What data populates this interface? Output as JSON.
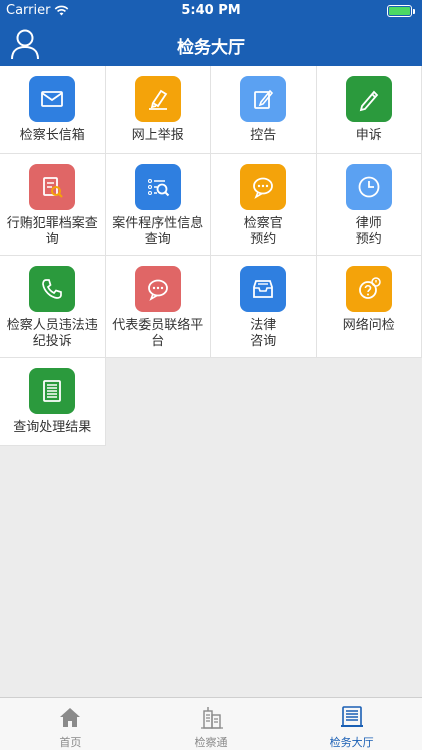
{
  "status_bar": {
    "carrier": "Carrier",
    "time": "5:40 PM",
    "battery_level": 1.0
  },
  "nav": {
    "title": "检务大厅"
  },
  "colors": {
    "primary": "#1a5fb4",
    "blue": "#2f7fe0",
    "orange": "#f4a30a",
    "light_blue": "#5ba1f2",
    "green": "#2b9a3d",
    "red": "#e06666"
  },
  "services": [
    {
      "label": "检察长信箱",
      "icon": "mail-icon",
      "color": "#2f7fe0"
    },
    {
      "label": "网上举报",
      "icon": "highlighter-icon",
      "color": "#f4a30a"
    },
    {
      "label": "控告",
      "icon": "edit-icon",
      "color": "#5ba1f2"
    },
    {
      "label": "申诉",
      "icon": "pencil-icon",
      "color": "#2b9a3d"
    },
    {
      "label": "行贿犯罪档案查询",
      "icon": "document-search-icon",
      "color": "#e06666"
    },
    {
      "label": "案件程序性信息查询",
      "icon": "list-search-icon",
      "color": "#2f7fe0"
    },
    {
      "label": "检察官\n预约",
      "icon": "chat-bubble-icon",
      "color": "#f4a30a"
    },
    {
      "label": "律师\n预约",
      "icon": "clock-icon",
      "color": "#5ba1f2"
    },
    {
      "label": "检察人员违法违纪投诉",
      "icon": "phone-icon",
      "color": "#2b9a3d"
    },
    {
      "label": "代表委员联络平台",
      "icon": "chat-bubble-icon",
      "color": "#e06666"
    },
    {
      "label": "法律\n咨询",
      "icon": "inbox-icon",
      "color": "#2f7fe0"
    },
    {
      "label": "网络问检",
      "icon": "question-bubble-icon",
      "color": "#f4a30a"
    },
    {
      "label": "查询处理结果",
      "icon": "document-list-icon",
      "color": "#2b9a3d"
    }
  ],
  "tabs": [
    {
      "label": "首页",
      "icon": "home-icon",
      "active": false
    },
    {
      "label": "检察通",
      "icon": "building-icon",
      "active": false
    },
    {
      "label": "检务大厅",
      "icon": "stack-icon",
      "active": true
    }
  ]
}
